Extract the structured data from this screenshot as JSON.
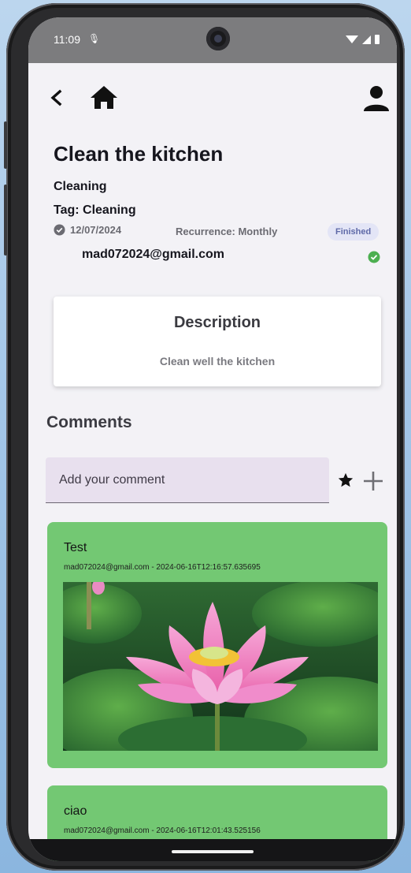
{
  "status_bar": {
    "time": "11:09"
  },
  "task": {
    "title": "Clean the kitchen",
    "category": "Cleaning",
    "tag": "Tag: Cleaning",
    "date": "12/07/2024",
    "recurrence": "Recurrence: Monthly",
    "status": "Finished",
    "assignee_email": "mad072024@gmail.com"
  },
  "description": {
    "title": "Description",
    "body": "Clean well the kitchen"
  },
  "comments": {
    "title": "Comments",
    "input_placeholder": "Add your comment",
    "items": [
      {
        "text": "Test",
        "meta": "mad072024@gmail.com - 2024-06-16T12:16:57.635695",
        "has_image": true
      },
      {
        "text": "ciao",
        "meta": "mad072024@gmail.com - 2024-06-16T12:01:43.525156",
        "has_image": false
      }
    ]
  },
  "colors": {
    "comment_card": "#73c873",
    "status_badge_bg": "#e3e5f6",
    "check_green": "#4caf50",
    "screen_bg": "#f3f2f6"
  },
  "icons": [
    "back-arrow-icon",
    "home-icon",
    "profile-icon",
    "check-circle-icon",
    "star-icon",
    "plus-icon",
    "wifi-icon",
    "signal-icon",
    "battery-icon",
    "mic-icon"
  ]
}
